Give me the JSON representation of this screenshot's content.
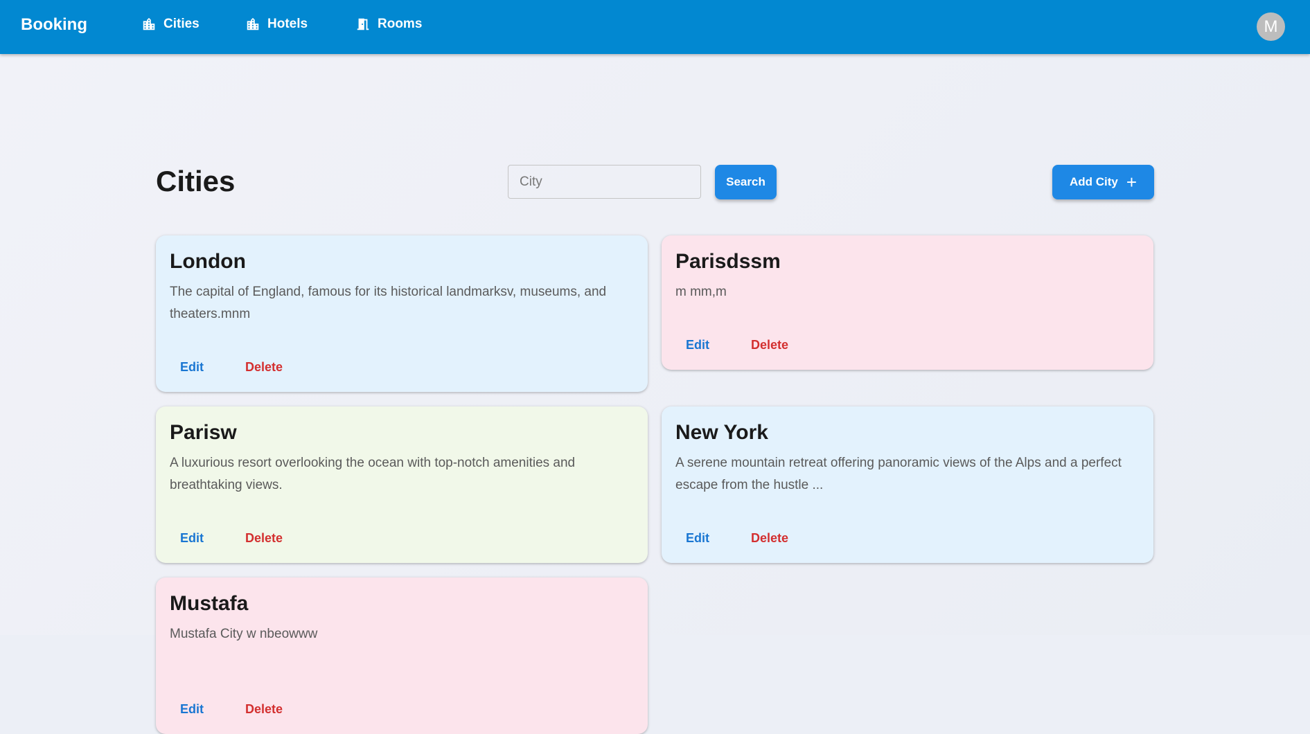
{
  "app": {
    "brand": "Booking",
    "nav": [
      {
        "label": "Cities",
        "icon": "city-icon"
      },
      {
        "label": "Hotels",
        "icon": "hotel-icon"
      },
      {
        "label": "Rooms",
        "icon": "door-icon"
      }
    ],
    "avatar_initial": "M",
    "colors": {
      "appbar": "#0288d1",
      "primary": "#1e88e5",
      "edit": "#1976d2",
      "delete": "#d32f2f"
    }
  },
  "page": {
    "title": "Cities",
    "search": {
      "placeholder": "City",
      "value": "",
      "button_label": "Search"
    },
    "add_button_label": "Add City",
    "add_button_icon": "plus-icon"
  },
  "cities": [
    {
      "name": "London",
      "description": "The capital of England, famous for its historical landmarksv, museums, and theaters.mnm",
      "color": "#e3f2fd",
      "edit_label": "Edit",
      "delete_label": "Delete"
    },
    {
      "name": "Parisdssm",
      "description": "m mm,m",
      "color": "#fce4ec",
      "edit_label": "Edit",
      "delete_label": "Delete"
    },
    {
      "name": "Parisw",
      "description": "A luxurious resort overlooking the ocean with top-notch amenities and breathtaking views.",
      "color": "#f1f8e9",
      "edit_label": "Edit",
      "delete_label": "Delete"
    },
    {
      "name": "New York",
      "description": "A serene mountain retreat offering panoramic views of the Alps and a perfect escape from the hustle ...",
      "color": "#e3f2fd",
      "edit_label": "Edit",
      "delete_label": "Delete"
    },
    {
      "name": "Mustafa",
      "description": "Mustafa City w nbeowww",
      "color": "#fce4ec",
      "edit_label": "Edit",
      "delete_label": "Delete"
    }
  ]
}
